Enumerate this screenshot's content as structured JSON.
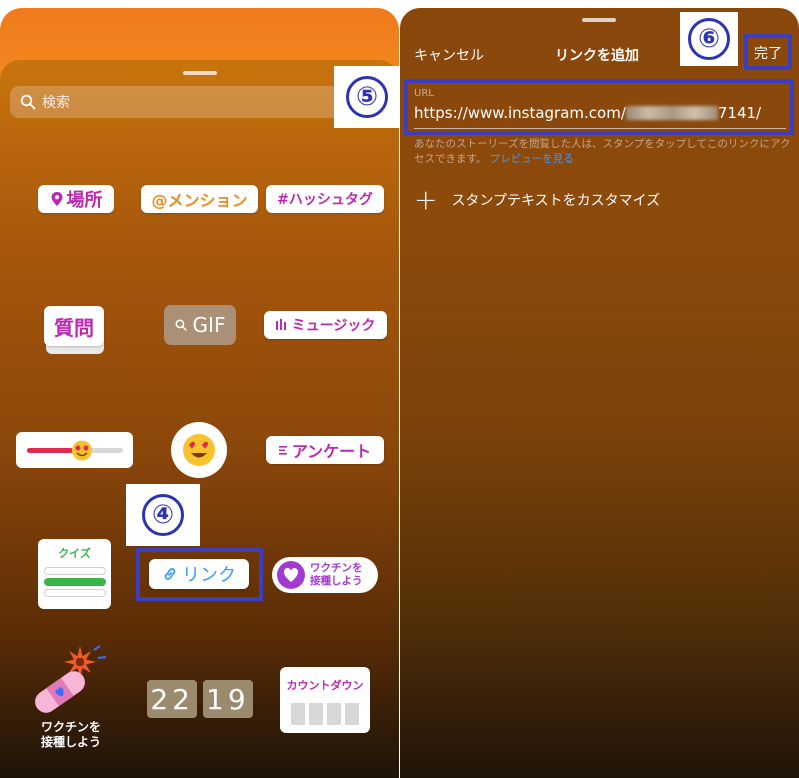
{
  "left": {
    "search_placeholder": "検索",
    "stickers": {
      "location": "場所",
      "mention": "@メンション",
      "hashtag": "#ハッシュタグ",
      "question": "質問",
      "gif": "GIF",
      "music": "ミュージック",
      "poll": "アンケート",
      "quiz": "クイズ",
      "link": "リンク",
      "vaccine": "ワクチンを接種しよう",
      "vaccine_line1": "ワクチンを",
      "vaccine_line2": "接種しよう",
      "countdown": "カウントダウン",
      "clock_hours": "22",
      "clock_minutes": "19"
    },
    "annotations": {
      "step4": "④",
      "step5": "⑤"
    }
  },
  "right": {
    "cancel": "キャンセル",
    "title": "リンクを追加",
    "done": "完了",
    "url_label": "URL",
    "url_prefix": "https://www.instagram.com/",
    "url_suffix": "7141/",
    "hint": "あなたのストーリーズを閲覧した人は、スタンプをタップしてこのリンクにアクセスできます。",
    "preview_link": "プレビューを見る",
    "customize": "スタンプテキストをカスタマイズ",
    "annotations": {
      "step6": "⑥"
    }
  },
  "colors": {
    "annotation": "#2d33b5",
    "sticker_purple": "#b92ab0",
    "sticker_orange": "#f08a1c",
    "link_blue": "#3a9dff"
  }
}
